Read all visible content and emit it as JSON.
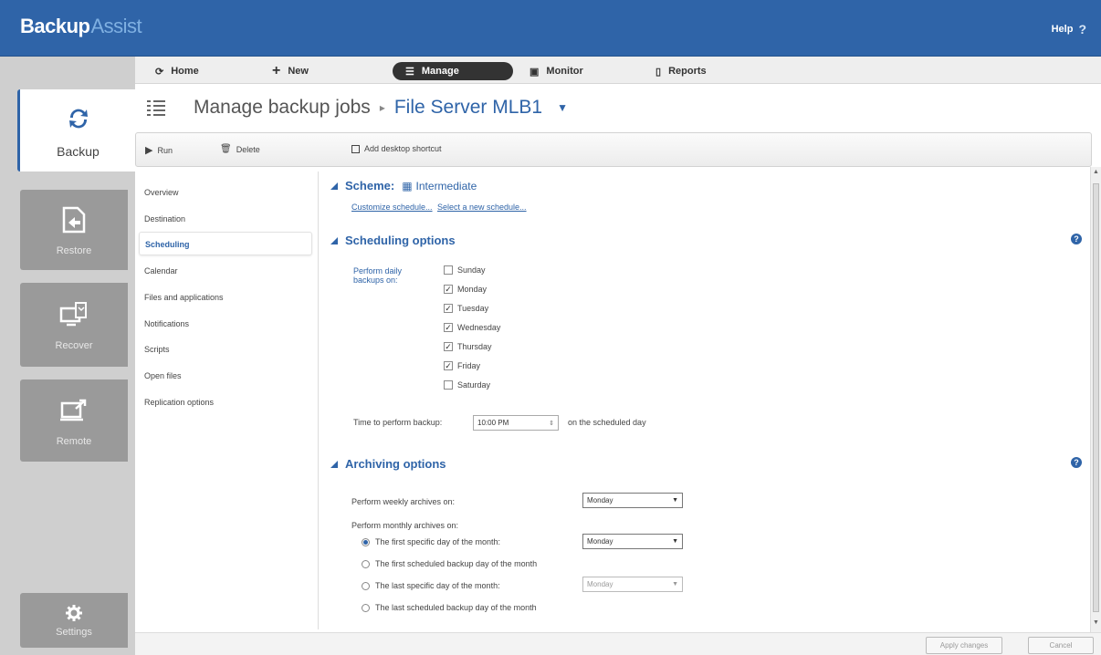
{
  "app": {
    "logo_main": "Backup",
    "logo_accent": "Assist",
    "help_label": "Help",
    "help_glyph": "?"
  },
  "nav": {
    "home": "Home",
    "new": "New",
    "manage": "Manage",
    "monitor": "Monitor",
    "reports": "Reports"
  },
  "sidebar": {
    "backup": "Backup",
    "restore": "Restore",
    "recover": "Recover",
    "remote": "Remote",
    "settings": "Settings"
  },
  "header": {
    "title": "Manage backup jobs",
    "separator": "▸",
    "job": "File Server MLB1"
  },
  "toolbar": {
    "run": "Run",
    "delete": "Delete",
    "shortcut": "Add desktop shortcut"
  },
  "menu": [
    "Overview",
    "Destination",
    "Scheduling",
    "Calendar",
    "Files and applications",
    "Notifications",
    "Scripts",
    "Open files",
    "Replication options"
  ],
  "scheme": {
    "label": "Scheme:",
    "value": "Intermediate",
    "customize_link": "Customize schedule...",
    "select_link": "Select a new schedule..."
  },
  "scheduling": {
    "title": "Scheduling options",
    "daily_label_1": "Perform daily",
    "daily_label_2": "backups on:",
    "days": [
      {
        "name": "Sunday",
        "checked": false
      },
      {
        "name": "Monday",
        "checked": true
      },
      {
        "name": "Tuesday",
        "checked": true
      },
      {
        "name": "Wednesday",
        "checked": true
      },
      {
        "name": "Thursday",
        "checked": true
      },
      {
        "name": "Friday",
        "checked": true
      },
      {
        "name": "Saturday",
        "checked": false
      }
    ],
    "time_label": "Time to perform backup:",
    "time_value": "10:00 PM",
    "time_suffix": "on the scheduled day"
  },
  "archiving": {
    "title": "Archiving options",
    "weekly_label": "Perform weekly archives on:",
    "weekly_value": "Monday",
    "monthly_label": "Perform monthly archives on:",
    "options": [
      {
        "label": "The first specific day of the month:",
        "selected": true,
        "select_value": "Monday",
        "enabled": true
      },
      {
        "label": "The first scheduled backup day of the month",
        "selected": false
      },
      {
        "label": "The last specific day of the month:",
        "selected": false,
        "select_value": "Monday",
        "enabled": false
      },
      {
        "label": "The last scheduled backup day of the month",
        "selected": false
      }
    ]
  },
  "footer": {
    "apply": "Apply changes",
    "cancel": "Cancel"
  },
  "colors": {
    "accent": "#2f64a8",
    "sidebar_bg": "#cfcfcf",
    "sidebar_btn": "#9a9a9a"
  }
}
